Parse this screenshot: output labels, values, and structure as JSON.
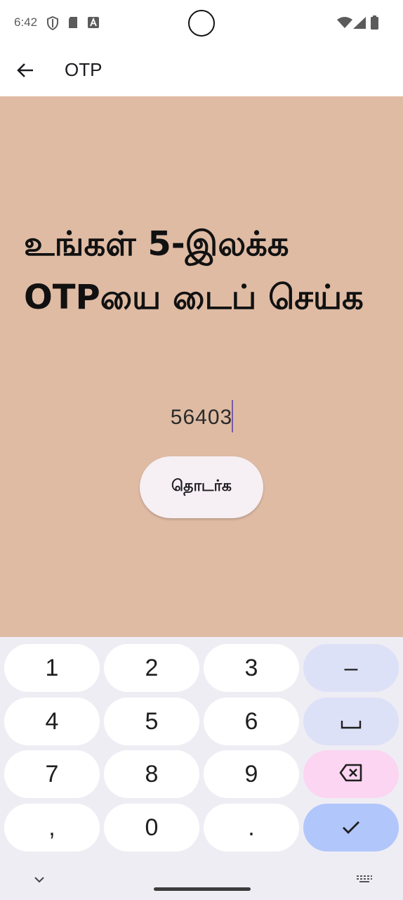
{
  "status_bar": {
    "time": "6:42",
    "left_icons": [
      "shield-icon",
      "sd-card-icon",
      "font-a-icon"
    ],
    "right_icons": [
      "wifi-icon",
      "signal-icon",
      "battery-icon"
    ]
  },
  "app_bar": {
    "back_icon": "arrow-left-icon",
    "title": "OTP"
  },
  "main": {
    "heading": "உங்கள் 5-இலக்க OTPயை டைப் செய்க",
    "otp_value": "56403",
    "continue_label": "தொடர்க",
    "background_color": "#dfbba4"
  },
  "keyboard": {
    "keys": {
      "k1": "1",
      "k2": "2",
      "k3": "3",
      "minus": "–",
      "k4": "4",
      "k5": "5",
      "k6": "6",
      "space": "␣",
      "k7": "7",
      "k8": "8",
      "k9": "9",
      "backspace": "⌫",
      "comma": ",",
      "k0": "0",
      "period": ".",
      "enter": "✓"
    },
    "hide_icon": "chevron-down-icon",
    "switch_icon": "keyboard-icon"
  }
}
